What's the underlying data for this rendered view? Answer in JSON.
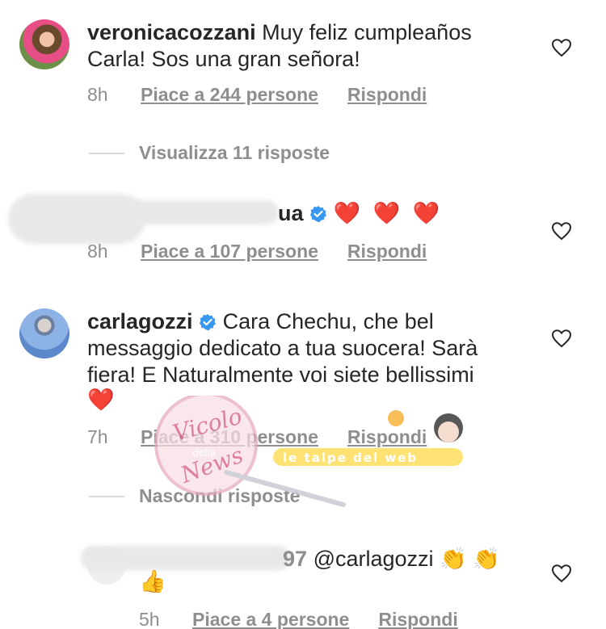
{
  "comments": [
    {
      "username": "veronicacozzani",
      "text_line1": "Muy feliz cumpleaños",
      "text_line2": "Carla! Sos una gran señora!",
      "time": "8h",
      "likes": "Piace a 244 persone",
      "reply": "Rispondi",
      "replies_toggle": "Visualizza 11 risposte"
    },
    {
      "username": "ua",
      "text": "❤️ ❤️ ❤️",
      "time": "8h",
      "likes": "Piace a 107 persone",
      "reply": "Rispondi"
    },
    {
      "username": "carlagozzi",
      "text_line1": "Cara Chechu, che bel",
      "text_line2": "messaggio dedicato a tua suocera! Sarà",
      "text_line3": "fiera! E Naturalmente voi siete bellissimi",
      "text_line4": "❤️",
      "time": "7h",
      "likes": "Piace a 310 persone",
      "reply": "Rispondi",
      "replies_toggle": "Nascondi risposte"
    },
    {
      "username": "97",
      "mention": "@carlagozzi",
      "emojis": "👏 👏",
      "emoji_line2": "👍",
      "time": "5h",
      "likes": "Piace a 4 persone",
      "reply": "Rispondi"
    }
  ],
  "watermark": {
    "text1": "Vicolo",
    "text2": "della",
    "text3": "News",
    "text4": "le talpe del web"
  },
  "colors": {
    "text": "#262626",
    "secondary": "#8e8e8e",
    "verified": "#3897f0",
    "heart": "#e0212b"
  }
}
